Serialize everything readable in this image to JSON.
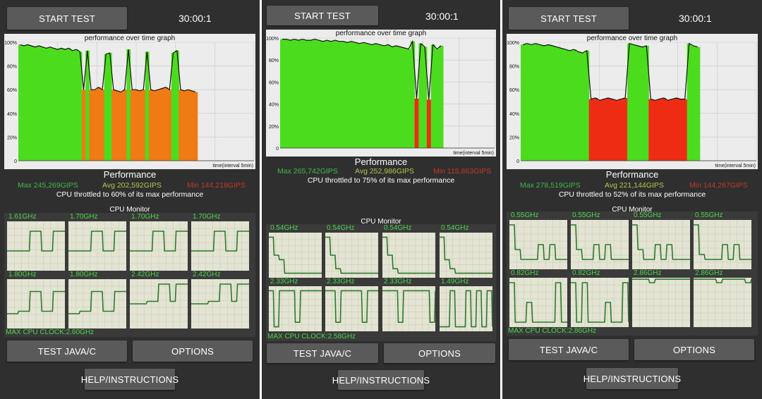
{
  "colors": {
    "background": "#2f2f2f",
    "button": "#5a5a5a",
    "graph_bg": "#ececec",
    "max_color": "#3fb84a",
    "avg_color": "#b8c34a",
    "min_color": "#c0392b",
    "core_text": "#4cd54c",
    "core_line": "#2a7a2a"
  },
  "panels": [
    {
      "start_label": "START TEST",
      "timer": "30:00:1",
      "graph_title": "performance over time graph",
      "y_ticks": [
        "100%",
        "80%",
        "60%",
        "40%",
        "20%",
        "0"
      ],
      "x_label": "time(interval 5min)",
      "performance_title": "Performance",
      "max": "Max 245,269GIPS",
      "avg": "Avg 202,592GIPS",
      "min": "Min 144,218GIPS",
      "throttle_text": "CPU throttled to 60% of its max performance",
      "cpu_monitor_title": "CPU Monitor",
      "cores": [
        "1.61GHz",
        "1.70GHz",
        "1.70GHz",
        "1.70GHz",
        "1.80GHz",
        "1.80GHz",
        "2.42GHz",
        "2.42GHz"
      ],
      "max_cpu_clock": "MAX CPU CLOCK:2.60GHz",
      "test_label": "TEST JAVA/C",
      "options_label": "OPTIONS",
      "help_label": "HELP/INSTRUCTIONS",
      "chart_data": {
        "type": "area",
        "title": "performance over time graph",
        "xlabel": "time(interval 5min)",
        "ylabel": "",
        "ylim": [
          0,
          100
        ],
        "y_unit": "%",
        "values": [
          98,
          97,
          98,
          97,
          96,
          97,
          96,
          95,
          96,
          95,
          94,
          95,
          94,
          95,
          93,
          94,
          92,
          60,
          93,
          60,
          60,
          62,
          60,
          90,
          91,
          60,
          59,
          58,
          60,
          94,
          60,
          60,
          59,
          60,
          92,
          60,
          59,
          60,
          61,
          62,
          60,
          91,
          93,
          60,
          59,
          60,
          59,
          58
        ]
      }
    },
    {
      "start_label": "START TEST",
      "timer": "30:00:1",
      "graph_title": "performance over time graph",
      "y_ticks": [
        "100%",
        "80%",
        "60%",
        "40%",
        "20%",
        "0"
      ],
      "x_label": "time(interval 5min)",
      "performance_title": "Performance",
      "max": "Max 265,742GIPS",
      "avg": "Avg 252,986GIPS",
      "min": "Min 115,863GIPS",
      "throttle_text": "CPU throttled to 75% of its max performance",
      "cpu_monitor_title": "CPU Monitor",
      "cores": [
        "0.54GHz",
        "0.54GHz",
        "0.54GHz",
        "0.54GHz",
        "2.33GHz",
        "2.33GHz",
        "2.33GHz",
        "1.49GHz"
      ],
      "max_cpu_clock": "MAX CPU CLOCK:2.58GHz",
      "test_label": "TEST JAVA/C",
      "options_label": "OPTIONS",
      "help_label": "HELP/INSTRUCTIONS",
      "chart_data": {
        "type": "area",
        "title": "performance over time graph",
        "xlabel": "time(interval 5min)",
        "ylabel": "",
        "ylim": [
          0,
          100
        ],
        "y_unit": "%",
        "values": [
          99,
          99,
          98,
          99,
          98,
          99,
          98,
          98,
          99,
          98,
          97,
          98,
          97,
          98,
          97,
          97,
          96,
          97,
          96,
          95,
          96,
          95,
          94,
          95,
          94,
          93,
          94,
          92,
          93,
          92,
          91,
          90,
          97,
          45,
          95,
          92,
          44,
          94,
          90,
          93
        ]
      }
    },
    {
      "start_label": "START TEST",
      "timer": "30:00:1",
      "graph_title": "performance over time graph",
      "y_ticks": [
        "100%",
        "80%",
        "60%",
        "40%",
        "20%",
        "0"
      ],
      "x_label": "time(interval 5min)",
      "performance_title": "Performance",
      "max": "Max 278,519GIPS",
      "avg": "Avg 221,144GIPS",
      "min": "Min 144,267GIPS",
      "throttle_text": "CPU throttled to 52% of its max performance",
      "cpu_monitor_title": "CPU Monitor",
      "cores": [
        "0.55GHz",
        "0.55GHz",
        "0.55GHz",
        "0.55GHz",
        "0.82GHz",
        "0.82GHz",
        "2.86GHz",
        "2.86GHz"
      ],
      "max_cpu_clock": "MAX CPU CLOCK:2.86GHz",
      "test_label": "TEST JAVA/C",
      "options_label": "OPTIONS",
      "help_label": "HELP/INSTRUCTIONS",
      "chart_data": {
        "type": "area",
        "title": "performance over time graph",
        "xlabel": "time(interval 5min)",
        "ylabel": "",
        "ylim": [
          0,
          100
        ],
        "y_unit": "%",
        "values": [
          98,
          99,
          98,
          99,
          98,
          97,
          98,
          97,
          96,
          95,
          94,
          93,
          94,
          92,
          91,
          93,
          52,
          53,
          51,
          52,
          53,
          52,
          51,
          52,
          53,
          99,
          98,
          97,
          96,
          97,
          52,
          51,
          52,
          53,
          51,
          52,
          53,
          52,
          52,
          99,
          97,
          96
        ]
      }
    }
  ],
  "core_series": [
    [
      [
        0.4,
        0.4,
        0.4,
        0.4,
        0.8,
        0.8,
        0.4,
        0.4,
        0.8,
        0.8,
        0.8
      ],
      [
        0.4,
        0.4,
        0.4,
        0.4,
        0.8,
        0.8,
        0.4,
        0.4,
        0.8,
        0.8,
        0.8
      ],
      [
        0.4,
        0.4,
        0.4,
        0.4,
        0.8,
        0.8,
        0.4,
        0.4,
        0.8,
        0.8,
        0.8
      ],
      [
        0.4,
        0.4,
        0.4,
        0.4,
        0.8,
        0.8,
        0.4,
        0.4,
        0.8,
        0.8,
        0.8
      ],
      [
        0.3,
        0.3,
        0.35,
        0.35,
        0.75,
        0.75,
        0.35,
        0.35,
        0.75,
        0.75,
        0.75
      ],
      [
        0.3,
        0.3,
        0.35,
        0.35,
        0.75,
        0.75,
        0.35,
        0.35,
        0.75,
        0.75,
        0.75
      ],
      [
        0.5,
        0.5,
        0.5,
        0.55,
        0.55,
        0.9,
        0.9,
        0.55,
        0.9,
        0.9,
        0.9
      ],
      [
        0.5,
        0.5,
        0.5,
        0.55,
        0.55,
        0.9,
        0.9,
        0.55,
        0.9,
        0.9,
        0.9
      ]
    ],
    [
      [
        0.9,
        0.5,
        0.4,
        0.1,
        0.1,
        0.1,
        0.1,
        0.1,
        0.1,
        0.1,
        0.1
      ],
      [
        0.9,
        0.5,
        0.2,
        0.1,
        0.1,
        0.1,
        0.1,
        0.1,
        0.1,
        0.1,
        0.1
      ],
      [
        0.9,
        0.5,
        0.2,
        0.1,
        0.1,
        0.1,
        0.1,
        0.1,
        0.1,
        0.1,
        0.1
      ],
      [
        0.9,
        0.4,
        0.2,
        0.1,
        0.1,
        0.1,
        0.1,
        0.1,
        0.1,
        0.1,
        0.1
      ],
      [
        0.9,
        0.1,
        0.9,
        0.9,
        0.9,
        0.2,
        0.9,
        0.9,
        0.9,
        0.9,
        0.9
      ],
      [
        0.9,
        0.9,
        0.2,
        0.9,
        0.9,
        0.9,
        0.9,
        0.2,
        0.9,
        0.9,
        0.9
      ],
      [
        0.9,
        0.9,
        0.9,
        0.2,
        0.9,
        0.9,
        0.9,
        0.9,
        0.9,
        0.2,
        0.9
      ],
      [
        0.1,
        0.1,
        0.9,
        0.1,
        0.1,
        0.9,
        0.1,
        0.9,
        0.1,
        0.9,
        0.1
      ]
    ],
    [
      [
        0.9,
        0.4,
        0.2,
        0.2,
        0.2,
        0.5,
        0.2,
        0.5,
        0.2,
        0.2,
        0.2
      ],
      [
        0.9,
        0.4,
        0.2,
        0.2,
        0.5,
        0.2,
        0.5,
        0.2,
        0.2,
        0.2,
        0.2
      ],
      [
        0.9,
        0.4,
        0.2,
        0.2,
        0.5,
        0.2,
        0.5,
        0.2,
        0.2,
        0.2,
        0.2
      ],
      [
        0.9,
        0.3,
        0.2,
        0.2,
        0.2,
        0.5,
        0.2,
        0.5,
        0.2,
        0.2,
        0.2
      ],
      [
        0.9,
        0.1,
        0.1,
        0.5,
        0.1,
        0.1,
        0.1,
        0.1,
        0.9,
        0.1,
        0.1
      ],
      [
        0.9,
        0.1,
        0.9,
        0.1,
        0.1,
        0.1,
        0.5,
        0.1,
        0.1,
        0.9,
        0.1
      ],
      [
        0.97,
        0.97,
        0.97,
        0.9,
        0.97,
        0.97,
        0.97,
        0.97,
        0.97,
        0.97,
        0.97
      ],
      [
        0.97,
        0.97,
        0.97,
        0.97,
        0.9,
        0.97,
        0.97,
        0.97,
        0.97,
        0.9,
        0.97
      ]
    ]
  ]
}
